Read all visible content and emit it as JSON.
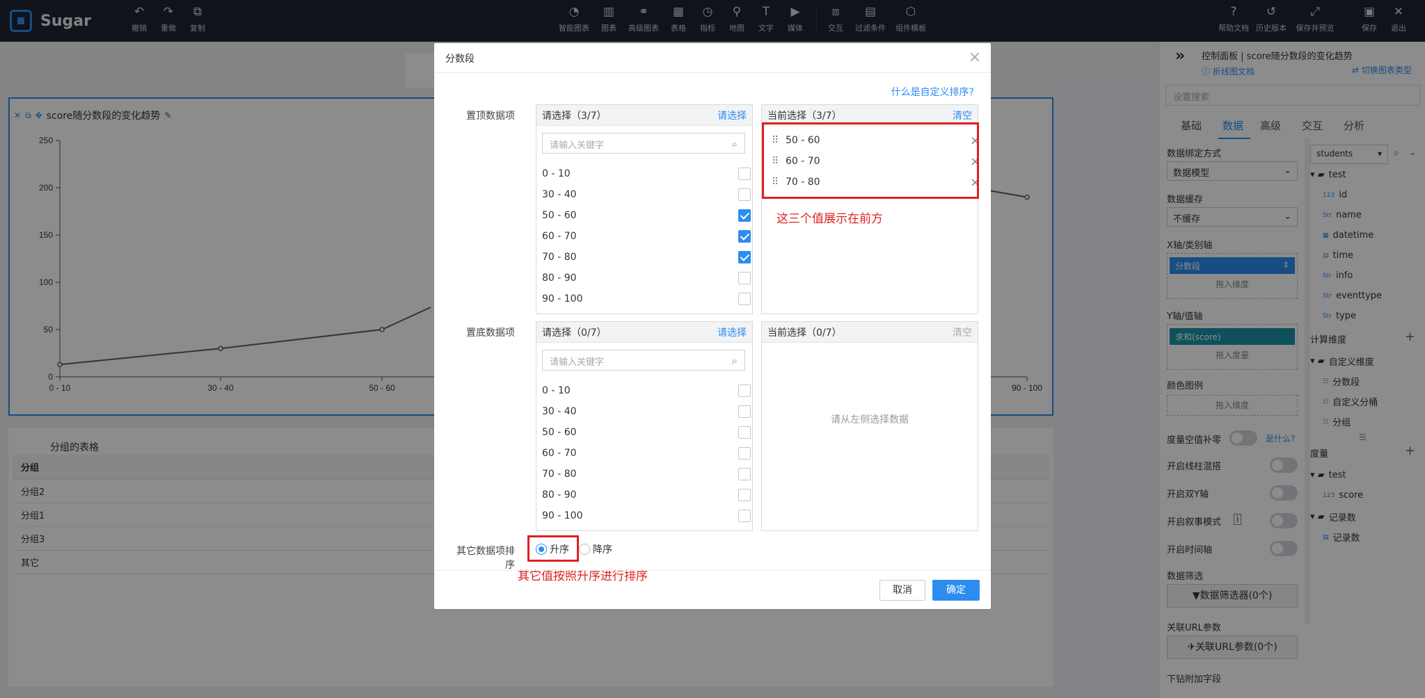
{
  "app": {
    "name": "Sugar"
  },
  "toolbar": {
    "left": [
      {
        "label": "撤销",
        "icon": "undo-icon"
      },
      {
        "label": "重做",
        "icon": "redo-icon"
      },
      {
        "label": "复制",
        "icon": "copy-icon"
      }
    ],
    "center": [
      {
        "label": "智能图表"
      },
      {
        "label": "图表"
      },
      {
        "label": "高级图表"
      },
      {
        "label": "表格"
      },
      {
        "label": "指标"
      },
      {
        "label": "地图"
      },
      {
        "label": "文字"
      },
      {
        "label": "媒体"
      },
      {
        "label": "交互"
      },
      {
        "label": "过滤条件"
      },
      {
        "label": "组件模板"
      }
    ],
    "right": [
      {
        "label": "帮助文档"
      },
      {
        "label": "历史版本"
      },
      {
        "label": "保存并预览"
      },
      {
        "label": "保存"
      },
      {
        "label": "退出"
      }
    ]
  },
  "chart": {
    "title": "score随分数段的变化趋势",
    "chart_data": {
      "type": "line",
      "categories": [
        "0 - 10",
        "30 - 40",
        "50 - 60",
        "90 - 100"
      ],
      "x": [
        "0 - 10",
        "30 - 40",
        "50 - 60",
        "90 - 100"
      ],
      "y": [
        13,
        30,
        50,
        190
      ],
      "yticks": [
        0,
        50,
        100,
        150,
        200,
        250
      ],
      "ylim": [
        0,
        250
      ]
    }
  },
  "table": {
    "title": "分组的表格",
    "header": "分组",
    "rows": [
      "分组2",
      "分组1",
      "分组3",
      "其它"
    ]
  },
  "right_panel": {
    "title": "控制面板 | score随分数段的变化趋势",
    "doc_link": "折线图文档",
    "switch_link": "切换图表类型",
    "search_placeholder": "设置搜索",
    "tabs": [
      "基础",
      "数据",
      "高级",
      "交互",
      "分析"
    ],
    "binding_label": "数据绑定方式",
    "binding_value": "数据模型",
    "cache_label": "数据缓存",
    "cache_value": "不缓存",
    "xaxis_label": "X轴/类别轴",
    "xaxis_field": "分数段",
    "drop_dim": "拖入维度",
    "yaxis_label": "Y轴/值轴",
    "yaxis_field": "求和(score)",
    "drop_measure": "拖入度量",
    "legend_label": "颜色图例",
    "legend_drop": "拖入维度",
    "null_fill": "度量空值补零",
    "what": "是什么?",
    "toggles": [
      "开启线柱混搭",
      "开启双Y轴",
      "开启叙事模式",
      "开启时间轴"
    ],
    "filter_label": "数据筛选",
    "filter_btn": "数据筛选器(0个)",
    "url_label": "关联URL参数",
    "url_btn": "关联URL参数(0个)",
    "drill_label": "下钻附加字段",
    "model": "students",
    "tree_test": "test",
    "fields": [
      {
        "tag": "123",
        "name": "id"
      },
      {
        "tag": "Str",
        "name": "name"
      },
      {
        "tag": "",
        "name": "datetime"
      },
      {
        "tag": "",
        "name": "time"
      },
      {
        "tag": "Str",
        "name": "info"
      },
      {
        "tag": "Str",
        "name": "eventtype"
      },
      {
        "tag": "Str",
        "name": "type"
      }
    ],
    "calc_dim": "计算维度",
    "custom_dim": "自定义维度",
    "custom_fields": [
      "分数段",
      "自定义分桶",
      "分组"
    ],
    "measure": "度量",
    "measure_test": "test",
    "measure_field": "score",
    "record_folder": "记录数",
    "record_field": "记录数"
  },
  "dialog": {
    "title": "分数段",
    "help_link": "什么是自定义排序?",
    "top_label": "置顶数据项",
    "bottom_label": "置底数据项",
    "other_label": "其它数据项排序",
    "top_left_head": "请选择（3/7）",
    "top_right_head": "当前选择（3/7）",
    "bottom_left_head": "请选择（0/7）",
    "bottom_right_head": "当前选择（0/7）",
    "choose": "请选择",
    "clear": "清空",
    "search_placeholder": "请输入关键字",
    "options": [
      "0 - 10",
      "30 - 40",
      "50 - 60",
      "60 - 70",
      "70 - 80",
      "80 - 90",
      "90 - 100"
    ],
    "top_checked": [
      false,
      false,
      true,
      true,
      true,
      false,
      false
    ],
    "top_selected": [
      "50 - 60",
      "60 - 70",
      "70 - 80"
    ],
    "empty_hint": "请从左侧选择数据",
    "asc": "升序",
    "desc": "降序",
    "annot_top": "这三个值展示在前方",
    "annot_bottom": "其它值按照升序进行排序",
    "cancel": "取消",
    "ok": "确定"
  }
}
